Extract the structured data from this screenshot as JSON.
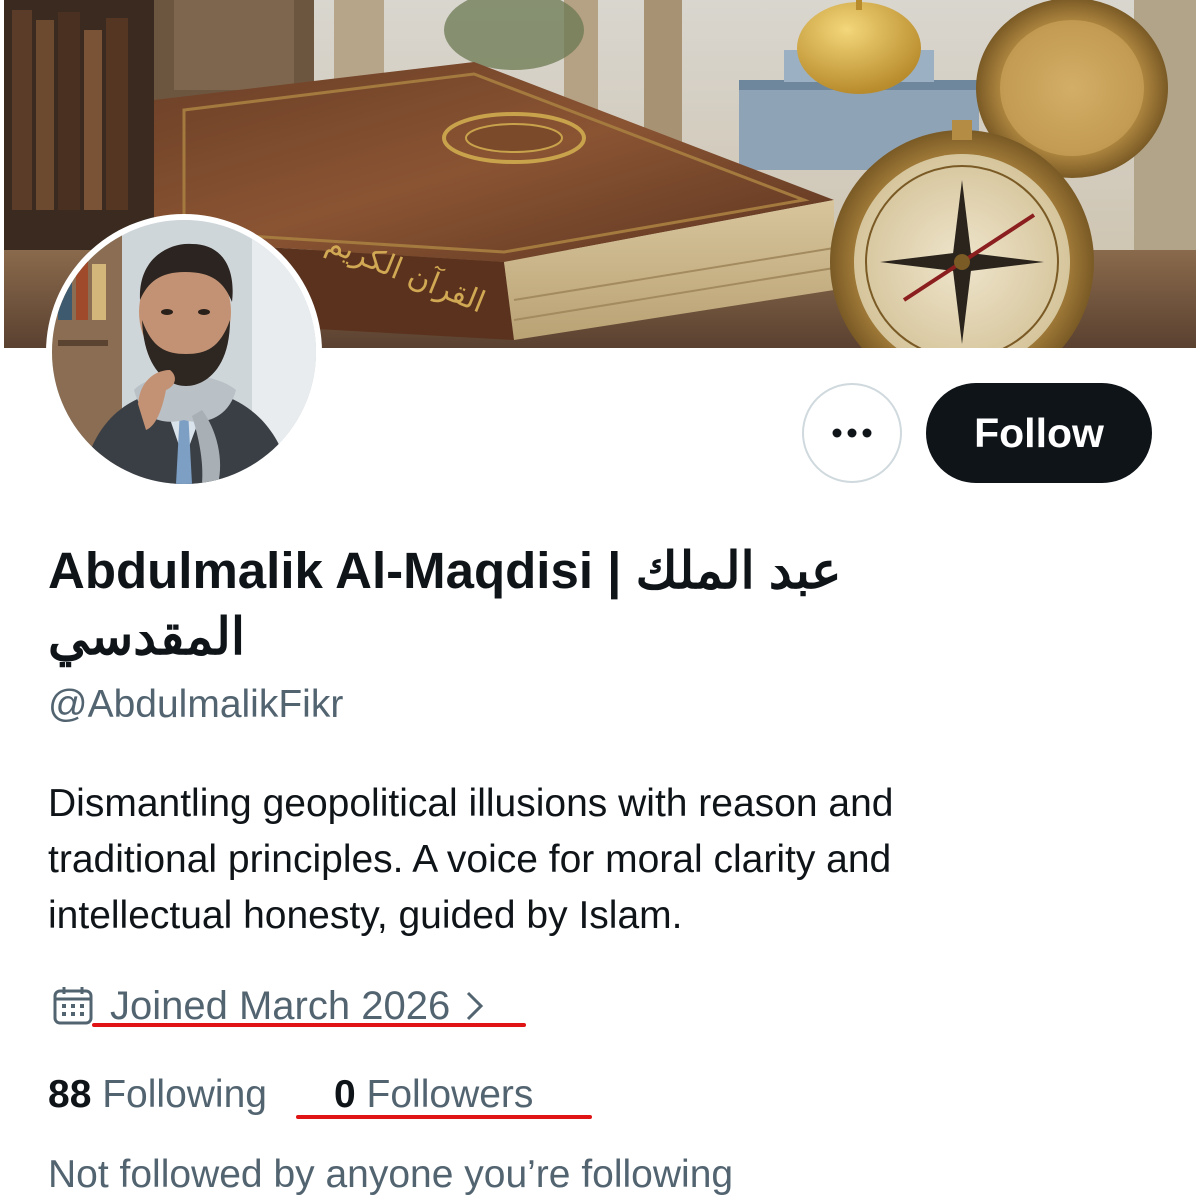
{
  "profile": {
    "display_name": "Abdulmalik Al-Maqdisi | عبد الملك المقدسي",
    "handle": "@AbdulmalikFikr",
    "bio": "Dismantling geopolitical illusions with reason and traditional principles. A voice for moral clarity and intellectual honesty, guided by Islam.",
    "joined": "Joined March 2026",
    "following_count": "88",
    "following_label": "Following",
    "followers_count": "0",
    "followers_label": "Followers",
    "mutuals_text": "Not followed by anyone you’re following"
  },
  "actions": {
    "more_icon": "more-horizontal-icon",
    "follow_label": "Follow"
  },
  "banner": {
    "description_icon": "banner-image",
    "book_title": "القرآن الكريم"
  },
  "colors": {
    "text_primary": "#0f1419",
    "text_secondary": "#536471",
    "follow_button_bg": "#0f1419",
    "border": "#cfd9de",
    "annotation_red": "#e01414"
  }
}
